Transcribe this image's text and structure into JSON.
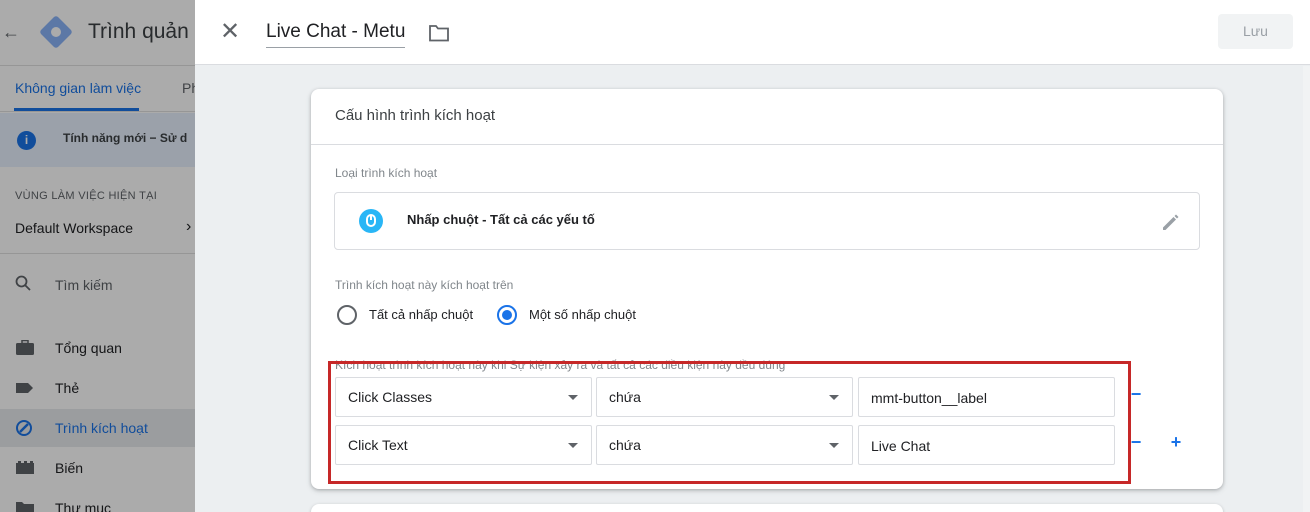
{
  "background_app": {
    "title": "Trình quản",
    "tabs": [
      {
        "label": "Không gian làm việc",
        "active": true
      },
      {
        "label": "Ph",
        "active": false
      }
    ],
    "notice": {
      "text": "Tính năng mới − Sử d"
    },
    "workspace": {
      "section_label": "VÙNG LÀM VIỆC HIỆN TẠI",
      "name": "Default Workspace"
    },
    "search": {
      "label": "Tìm kiếm"
    },
    "nav": [
      {
        "label": "Tổng quan",
        "icon": "briefcase-icon",
        "active": false
      },
      {
        "label": "Thẻ",
        "icon": "tag-icon",
        "active": false
      },
      {
        "label": "Trình kích hoạt",
        "icon": "trigger-icon",
        "active": true
      },
      {
        "label": "Biến",
        "icon": "variables-icon",
        "active": false
      },
      {
        "label": "Thư mục",
        "icon": "folder-icon",
        "active": false
      }
    ]
  },
  "drawer": {
    "title": "Live Chat - Metu",
    "save_label": "Lưu",
    "card": {
      "title": "Cấu hình trình kích hoạt",
      "trigger_type_label": "Loại trình kích hoạt",
      "trigger_type_value": "Nhấp chuột - Tất cả các yếu tố",
      "fires_on_label": "Trình kích hoạt này kích hoạt trên",
      "radio_all": "Tất cả nhấp chuột",
      "radio_some": "Một số nhấp chuột",
      "selected_option": "Một số nhấp chuột",
      "conditions_label": "Kích hoạt trình kích hoạt này khi Sự kiện xảy ra và tất cả các điều kiện này đều đúng",
      "conditions": [
        {
          "variable": "Click Classes",
          "operator": "chứa",
          "value": "mmt-button__label",
          "remove": "−"
        },
        {
          "variable": "Click Text",
          "operator": "chứa",
          "value": "Live Chat",
          "remove": "−",
          "add": "+"
        }
      ]
    }
  },
  "colors": {
    "accent": "#1a73e8",
    "highlight_border": "#c62828",
    "trigger_icon": "#29b6f6"
  }
}
